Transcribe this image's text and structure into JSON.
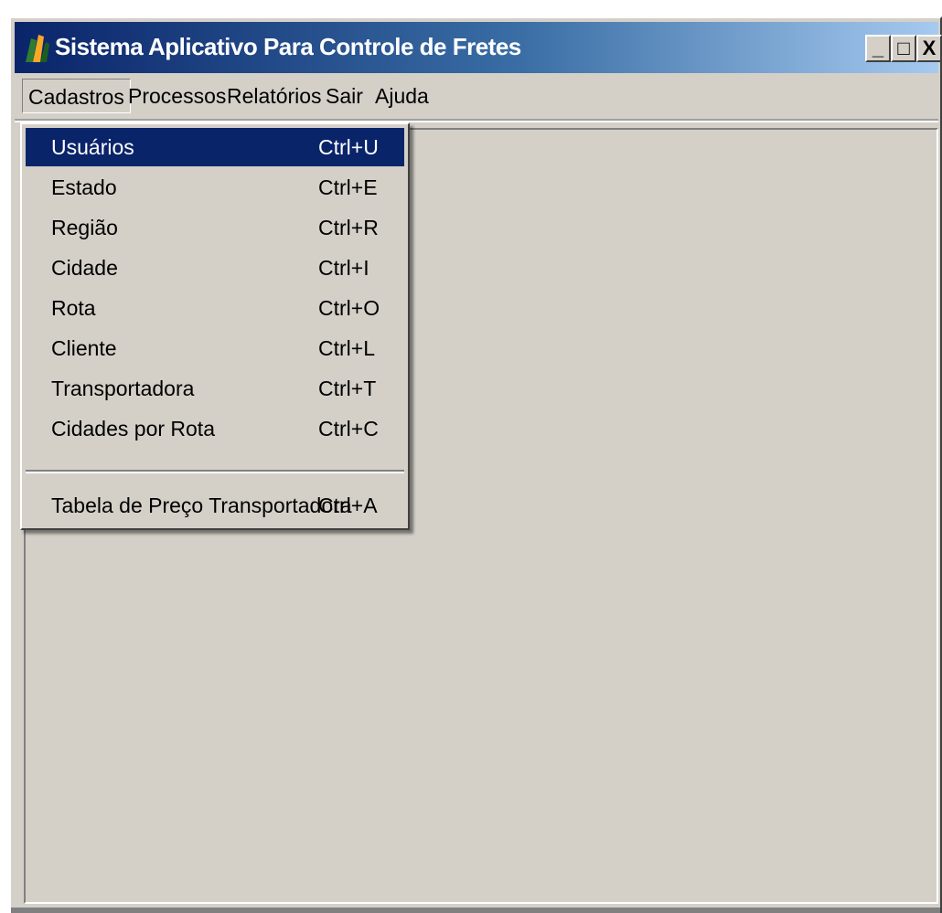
{
  "window": {
    "title": "Sistema Aplicativo Para Controle de Fretes",
    "icon": "app-logo-icon",
    "controls": {
      "minimize": "_",
      "maximize": "□",
      "close": "X"
    },
    "colors": {
      "titlebar_start": "#0a246a",
      "titlebar_end": "#a6caf0",
      "face": "#d4d0c8",
      "highlight": "#0a246a"
    }
  },
  "menubar": {
    "items": [
      {
        "label": "Cadastros",
        "active": true
      },
      {
        "label": "Processos"
      },
      {
        "label": "Relatórios"
      },
      {
        "label": "Sair"
      },
      {
        "label": "Ajuda"
      }
    ]
  },
  "dropdown": {
    "items": [
      {
        "label": "Usuários",
        "shortcut": "Ctrl+U",
        "highlighted": true
      },
      {
        "label": "Estado",
        "shortcut": "Ctrl+E"
      },
      {
        "label": "Região",
        "shortcut": "Ctrl+R"
      },
      {
        "label": "Cidade",
        "shortcut": "Ctrl+I"
      },
      {
        "label": "Rota",
        "shortcut": "Ctrl+O"
      },
      {
        "label": "Cliente",
        "shortcut": "Ctrl+L"
      },
      {
        "label": "Transportadora",
        "shortcut": "Ctrl+T"
      },
      {
        "label": "Cidades por Rota",
        "shortcut": "Ctrl+C"
      },
      {
        "label": "Tabela de Preço Transportadora",
        "shortcut": "Ctrl+A"
      }
    ]
  }
}
